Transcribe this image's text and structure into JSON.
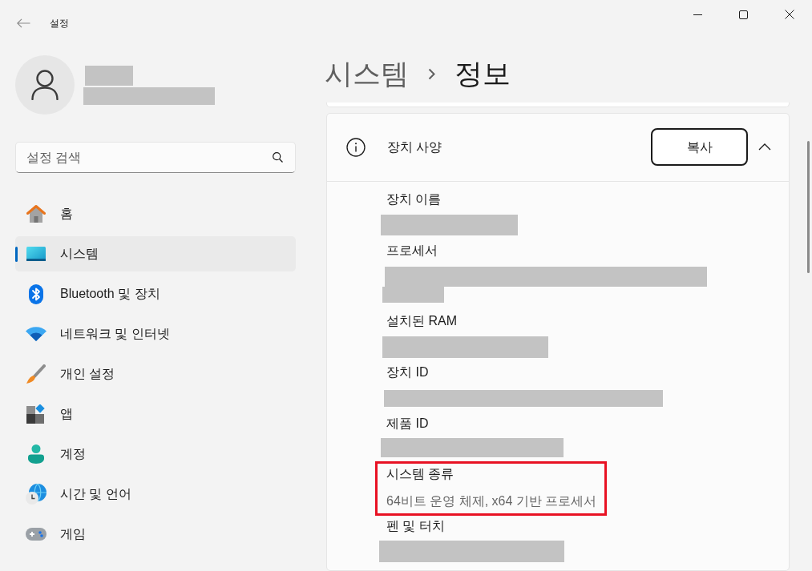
{
  "window": {
    "title": "설정"
  },
  "search": {
    "placeholder": "설정 검색"
  },
  "sidebar": {
    "items": [
      {
        "label": "홈",
        "selected": false
      },
      {
        "label": "시스템",
        "selected": true
      },
      {
        "label": "Bluetooth 및 장치",
        "selected": false
      },
      {
        "label": "네트워크 및 인터넷",
        "selected": false
      },
      {
        "label": "개인 설정",
        "selected": false
      },
      {
        "label": "앱",
        "selected": false
      },
      {
        "label": "계정",
        "selected": false
      },
      {
        "label": "시간 및 언어",
        "selected": false
      },
      {
        "label": "게임",
        "selected": false
      }
    ]
  },
  "breadcrumb": [
    {
      "label": "시스템",
      "current": false
    },
    {
      "label": "정보",
      "current": true
    }
  ],
  "device_specs": {
    "title": "장치 사양",
    "copy_button": "복사",
    "expanded": true,
    "items": [
      {
        "label": "장치 이름",
        "redacted": true,
        "highlighted": false
      },
      {
        "label": "프로세서",
        "redacted": true,
        "highlighted": false
      },
      {
        "label": "설치된 RAM",
        "redacted": true,
        "highlighted": false
      },
      {
        "label": "장치 ID",
        "redacted": true,
        "highlighted": false
      },
      {
        "label": "제품 ID",
        "redacted": true,
        "highlighted": false
      },
      {
        "label": "시스템 종류",
        "value": "64비트 운영 체제, x64 기반 프로세서",
        "redacted": false,
        "highlighted": true
      },
      {
        "label": "펜 및 터치",
        "redacted": true,
        "highlighted": false
      }
    ]
  }
}
